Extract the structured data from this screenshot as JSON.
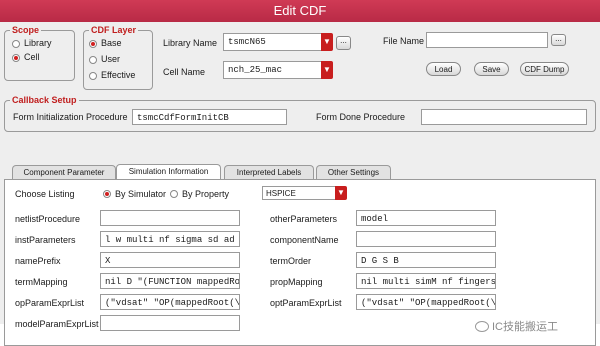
{
  "window": {
    "title": "Edit CDF"
  },
  "scope": {
    "title": "Scope",
    "options": [
      {
        "label": "Library",
        "selected": false
      },
      {
        "label": "Cell",
        "selected": true
      }
    ]
  },
  "cdf_layer": {
    "title": "CDF Layer",
    "options": [
      {
        "label": "Base",
        "selected": true
      },
      {
        "label": "User",
        "selected": false
      },
      {
        "label": "Effective",
        "selected": false
      }
    ]
  },
  "library": {
    "label": "Library Name",
    "value": "tsmcN65",
    "browse": "..."
  },
  "cell": {
    "label": "Cell Name",
    "value": "nch_25_mac"
  },
  "file": {
    "label": "File Name",
    "value": "",
    "browse": "..."
  },
  "buttons": {
    "load": "Load",
    "save": "Save",
    "dump": "CDF Dump"
  },
  "callback": {
    "title": "Callback Setup",
    "init_label": "Form Initialization Procedure",
    "init_value": "tsmcCdfFormInitCB",
    "done_label": "Form Done Procedure",
    "done_value": ""
  },
  "tabs": [
    {
      "label": "Component Parameter",
      "active": false
    },
    {
      "label": "Simulation Information",
      "active": true
    },
    {
      "label": "Interpreted Labels",
      "active": false
    },
    {
      "label": "Other Settings",
      "active": false
    }
  ],
  "sim": {
    "listing_label": "Choose Listing",
    "by_simulator": "By Simulator",
    "by_property": "By Property",
    "simulator": "HSPICE",
    "left_fields": [
      {
        "label": "netlistProcedure",
        "value": ""
      },
      {
        "label": "instParameters",
        "value": "l w multi nf sigma sd ad as"
      },
      {
        "label": "namePrefix",
        "value": "X"
      },
      {
        "label": "termMapping",
        "value": "nil D \"(FUNCTION mappedRoot("
      },
      {
        "label": "opParamExprList",
        "value": "(\"vdsat\" \"OP(mappedRoot(\\\".M"
      },
      {
        "label": "modelParamExprList",
        "value": ""
      }
    ],
    "right_fields": [
      {
        "label": "otherParameters",
        "value": "model"
      },
      {
        "label": "componentName",
        "value": ""
      },
      {
        "label": "termOrder",
        "value": "D G S B"
      },
      {
        "label": "propMapping",
        "value": "nil multi simM nf fingers w"
      },
      {
        "label": "optParamExprList",
        "value": "(\"vdsat\" \"OP(mappedRoot(\\\".M"
      }
    ]
  },
  "watermark": "IC技能搬运工",
  "colors": {
    "title_bar": "#c4324e",
    "accent": "#c81e1e"
  }
}
